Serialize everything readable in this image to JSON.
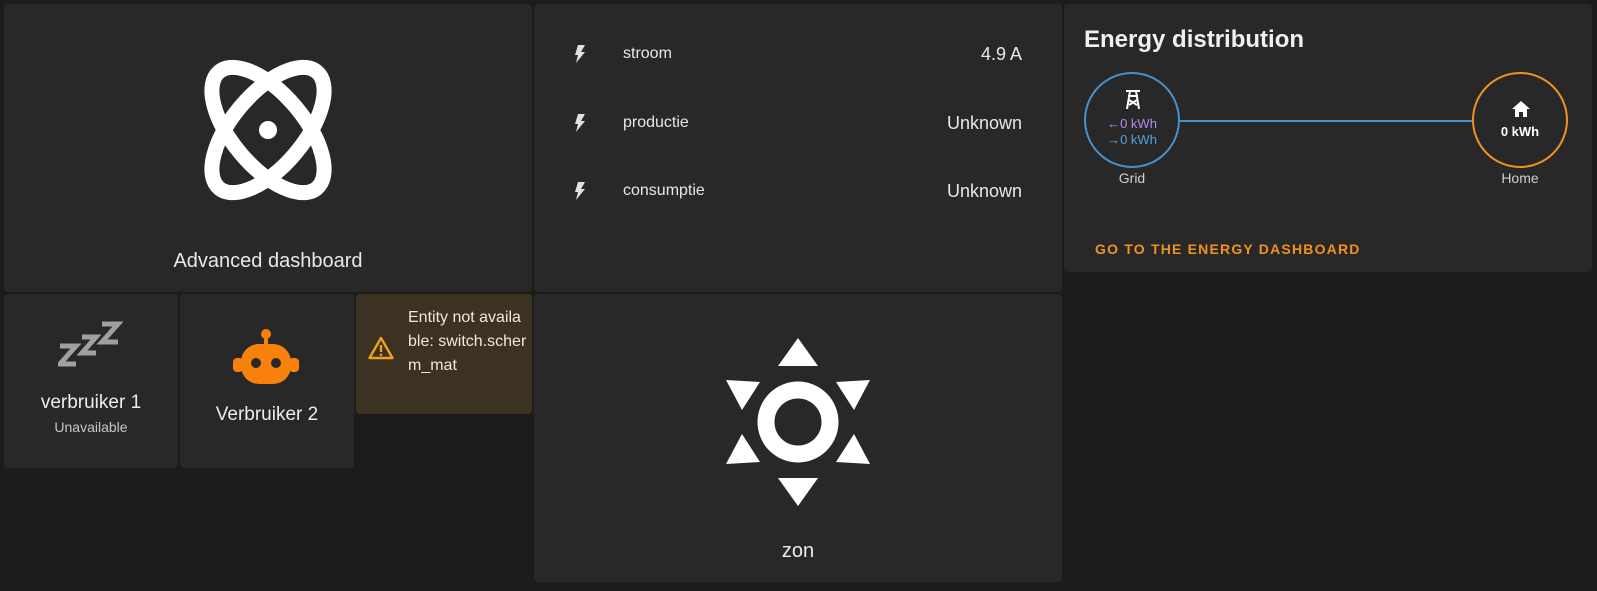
{
  "advanced": {
    "title": "Advanced dashboard",
    "icon": "atom-icon"
  },
  "entities": [
    {
      "name": "stroom",
      "value": "4.9 A",
      "icon": "flash-icon"
    },
    {
      "name": "productie",
      "value": "Unknown",
      "icon": "flash-icon"
    },
    {
      "name": "consumptie",
      "value": "Unknown",
      "icon": "flash-icon"
    }
  ],
  "energy": {
    "title": "Energy distribution",
    "grid": {
      "label": "Grid",
      "import": "0 kWh",
      "export": "0 kWh",
      "import_arrow": "←",
      "export_arrow": "→",
      "color": "#4a90c8",
      "import_color": "#b48cf0",
      "export_color": "#5b9fd8"
    },
    "home": {
      "label": "Home",
      "value": "0 kWh",
      "color": "#f2921e"
    },
    "link": "GO TO THE ENERGY DASHBOARD"
  },
  "verbruiker1": {
    "name": "verbruiker 1",
    "state": "Unavailable",
    "icon": "sleep-icon"
  },
  "verbruiker2": {
    "name": "Verbruiker 2",
    "icon": "robot-icon",
    "icon_color": "#f7810b"
  },
  "warning": {
    "text": "Entity not available: switch.scherm_mat",
    "icon": "alert-icon",
    "color": "#f0a020"
  },
  "zon": {
    "name": "zon",
    "icon": "sun-icon"
  }
}
